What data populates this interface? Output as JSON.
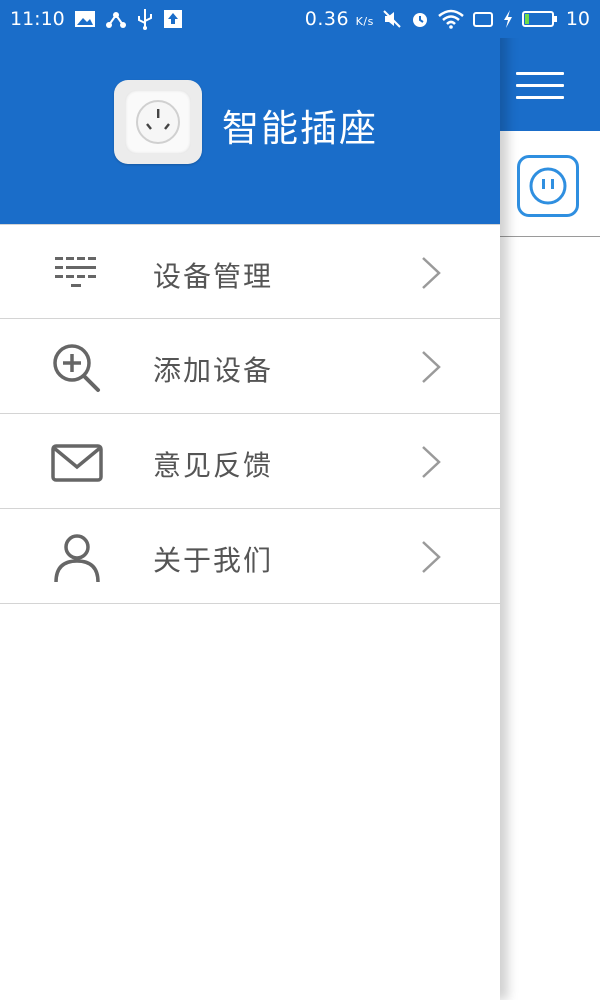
{
  "status_bar": {
    "time": "11:10",
    "net_speed": "0.36",
    "net_speed_unit": "K/s",
    "battery": "10"
  },
  "drawer": {
    "app_title": "智能插座",
    "items": [
      {
        "label": "设备管理",
        "icon": "list-icon"
      },
      {
        "label": "添加设备",
        "icon": "zoom-in-icon"
      },
      {
        "label": "意见反馈",
        "icon": "mail-icon"
      },
      {
        "label": "关于我们",
        "icon": "user-icon"
      }
    ]
  },
  "colors": {
    "primary": "#1a6dc9",
    "icon_gray": "#666666",
    "device_blue": "#2f8fe0"
  }
}
